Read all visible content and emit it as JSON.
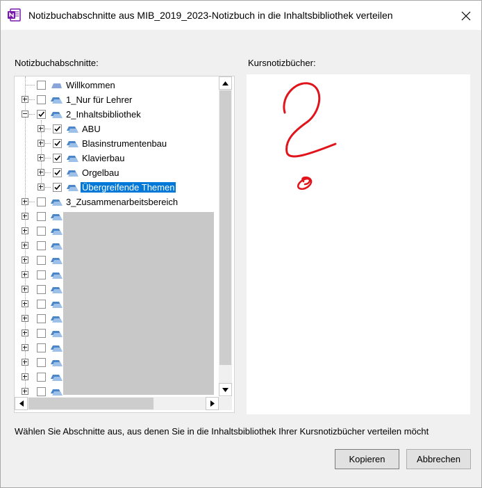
{
  "window": {
    "title": "Notizbuchabschnitte aus MIB_2019_2023-Notizbuch in die Inhaltsbibliothek verteilen"
  },
  "left_pane": {
    "label": "Notizbuchabschnitte:",
    "items": [
      {
        "label": "Willkommen",
        "checked": false,
        "expander": "none",
        "selected": false
      },
      {
        "label": "1_Nur für Lehrer",
        "checked": false,
        "expander": "plus",
        "selected": false
      },
      {
        "label": "2_Inhaltsbibliothek",
        "checked": true,
        "expander": "minus",
        "selected": false
      },
      {
        "label": "ABU",
        "checked": true,
        "expander": "plus",
        "selected": false
      },
      {
        "label": "Blasinstrumentenbau",
        "checked": true,
        "expander": "plus",
        "selected": false
      },
      {
        "label": "Klavierbau",
        "checked": true,
        "expander": "plus",
        "selected": false
      },
      {
        "label": "Orgelbau",
        "checked": true,
        "expander": "plus",
        "selected": false
      },
      {
        "label": "Übergreifende Themen",
        "checked": true,
        "expander": "plus",
        "selected": true
      },
      {
        "label": "3_Zusammenarbeitsbereich",
        "checked": false,
        "expander": "plus",
        "selected": false
      }
    ]
  },
  "right_pane": {
    "label": "Kursnotizbücher:"
  },
  "instruction": "Wählen Sie Abschnitte aus, aus denen Sie in die Inhaltsbibliothek Ihrer Kursnotizbücher verteilen möcht",
  "buttons": {
    "copy": "Kopieren",
    "cancel": "Abbrechen"
  },
  "colors": {
    "selection": "#0078d7",
    "section_icon": "#4a86c8",
    "annotation": "#e0141a"
  }
}
